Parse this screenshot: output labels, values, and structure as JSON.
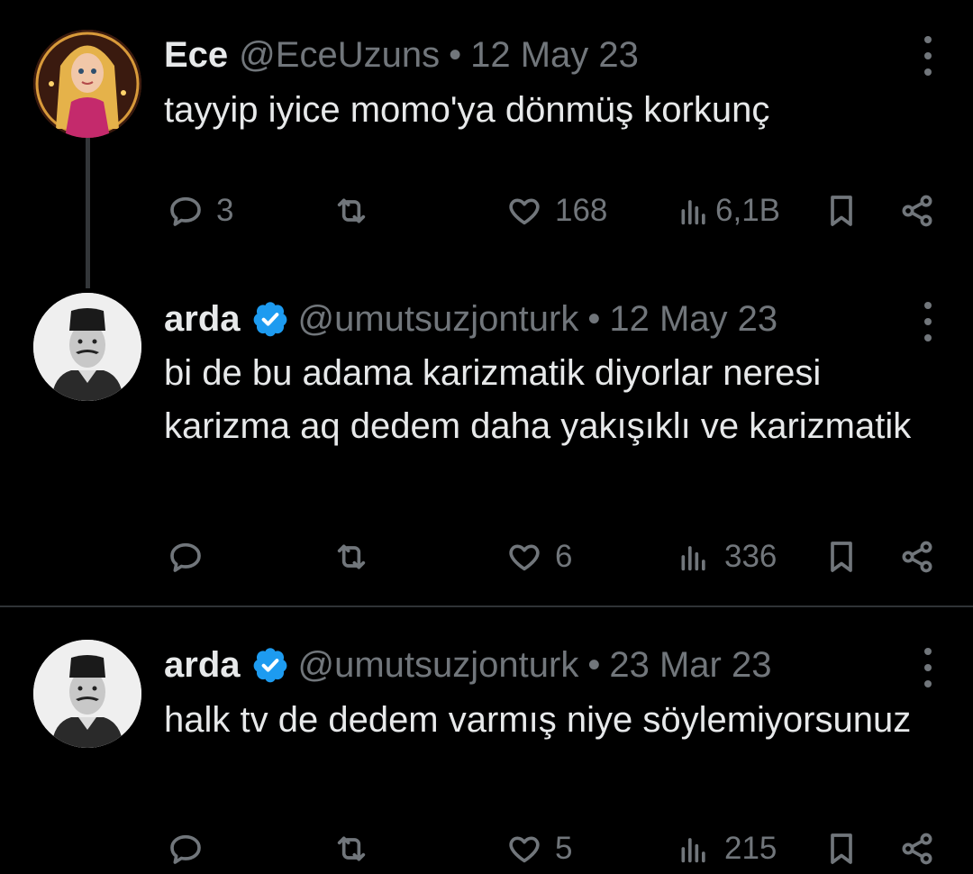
{
  "tweets": [
    {
      "name": "Ece",
      "handle": "@EceUzuns",
      "separator": "•",
      "date": "12 May 23",
      "verified": false,
      "text": "tayyip iyice momo'ya dönmüş korkunç",
      "replies": "3",
      "retweets": "",
      "likes": "168",
      "views": "6,1B"
    },
    {
      "name": "arda",
      "handle": "@umutsuzjonturk",
      "separator": "•",
      "date": "12 May 23",
      "verified": true,
      "text": "bi de bu adama karizmatik diyorlar neresi karizma aq dedem daha yakışıklı ve karizmatik",
      "replies": "",
      "retweets": "",
      "likes": "6",
      "views": "336"
    },
    {
      "name": "arda",
      "handle": "@umutsuzjonturk",
      "separator": "•",
      "date": "23 Mar 23",
      "verified": true,
      "text": "halk tv de dedem varmış niye söylemiyorsunuz",
      "replies": "",
      "retweets": "",
      "likes": "5",
      "views": "215"
    }
  ],
  "colors": {
    "background": "#000000",
    "text": "#e7e9ea",
    "muted": "#71767b",
    "verified": "#1d9bf0",
    "divider": "#2f3336"
  },
  "icons": [
    "reply-icon",
    "retweet-icon",
    "like-icon",
    "views-icon",
    "bookmark-icon",
    "share-icon",
    "more-icon",
    "verified-icon"
  ]
}
